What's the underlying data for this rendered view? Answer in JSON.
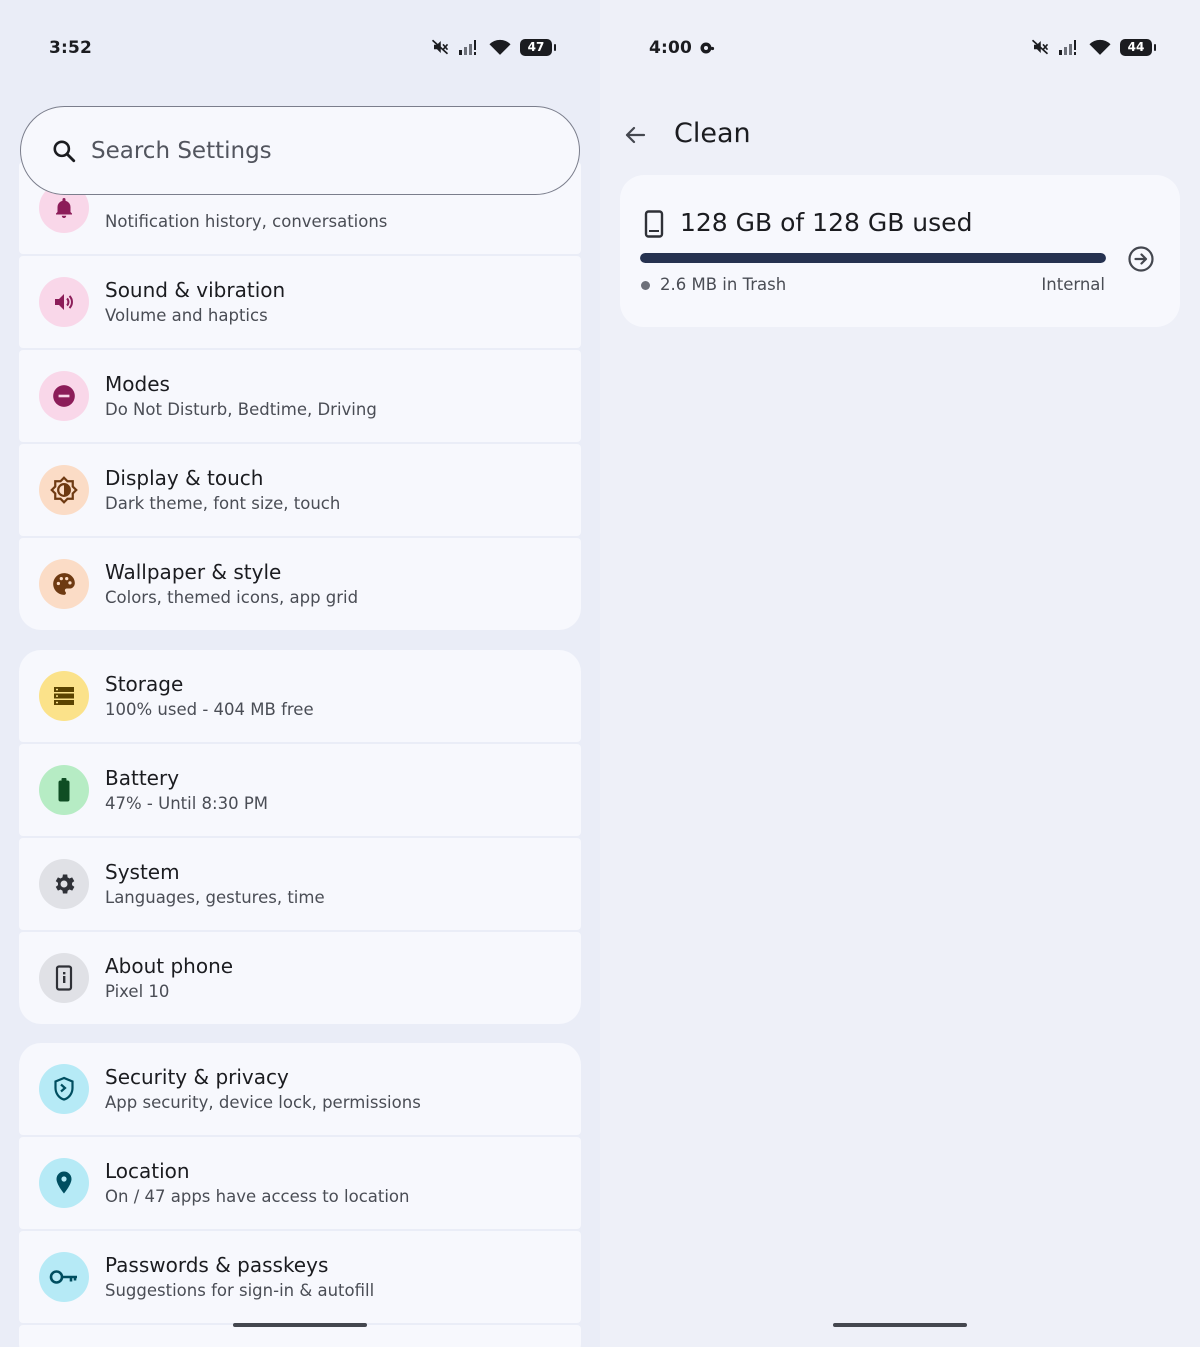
{
  "left_screen": {
    "status": {
      "time": "3:52",
      "battery": "47"
    },
    "search": {
      "placeholder": "Search Settings"
    },
    "group_notifications_partial": {
      "items": [
        {
          "title": "",
          "subtitle": "Notification history, conversations",
          "icon": "bell-icon"
        },
        {
          "title": "Sound & vibration",
          "subtitle": "Volume and haptics",
          "icon": "speaker-icon"
        },
        {
          "title": "Modes",
          "subtitle": "Do Not Disturb, Bedtime, Driving",
          "icon": "do-not-disturb-icon"
        },
        {
          "title": "Display & touch",
          "subtitle": "Dark theme, font size, touch",
          "icon": "brightness-icon"
        },
        {
          "title": "Wallpaper & style",
          "subtitle": "Colors, themed icons, app grid",
          "icon": "palette-icon"
        }
      ]
    },
    "group_device": {
      "items": [
        {
          "title": "Storage",
          "subtitle": "100% used - 404 MB free",
          "icon": "storage-icon"
        },
        {
          "title": "Battery",
          "subtitle": "47% - Until 8:30 PM",
          "icon": "battery-icon"
        },
        {
          "title": "System",
          "subtitle": "Languages, gestures, time",
          "icon": "gear-icon"
        },
        {
          "title": "About phone",
          "subtitle": "Pixel 10",
          "icon": "phone-info-icon"
        }
      ]
    },
    "group_security": {
      "items": [
        {
          "title": "Security & privacy",
          "subtitle": "App security, device lock, permissions",
          "icon": "shield-icon"
        },
        {
          "title": "Location",
          "subtitle": "On / 47 apps have access to location",
          "icon": "location-pin-icon"
        },
        {
          "title": "Passwords & passkeys",
          "subtitle": "Suggestions for sign-in & autofill",
          "icon": "key-icon"
        }
      ]
    }
  },
  "right_screen": {
    "status": {
      "time": "4:00",
      "battery": "44"
    },
    "header": {
      "title": "Clean"
    },
    "storage_card": {
      "used_text": "128 GB of 128 GB used",
      "used_fraction": 1.0,
      "trash_text": "2.6 MB in Trash",
      "volume_label": "Internal"
    }
  },
  "colors": {
    "accent_dark": "#263250",
    "pink_tint": "#f9d7e9",
    "orange_tint": "#fbdcc6",
    "yellow_tint": "#fbe28a",
    "green_tint": "#b6ecc4",
    "grey_tint": "#e0e1e6",
    "cyan_tint": "#b6eaf6"
  }
}
